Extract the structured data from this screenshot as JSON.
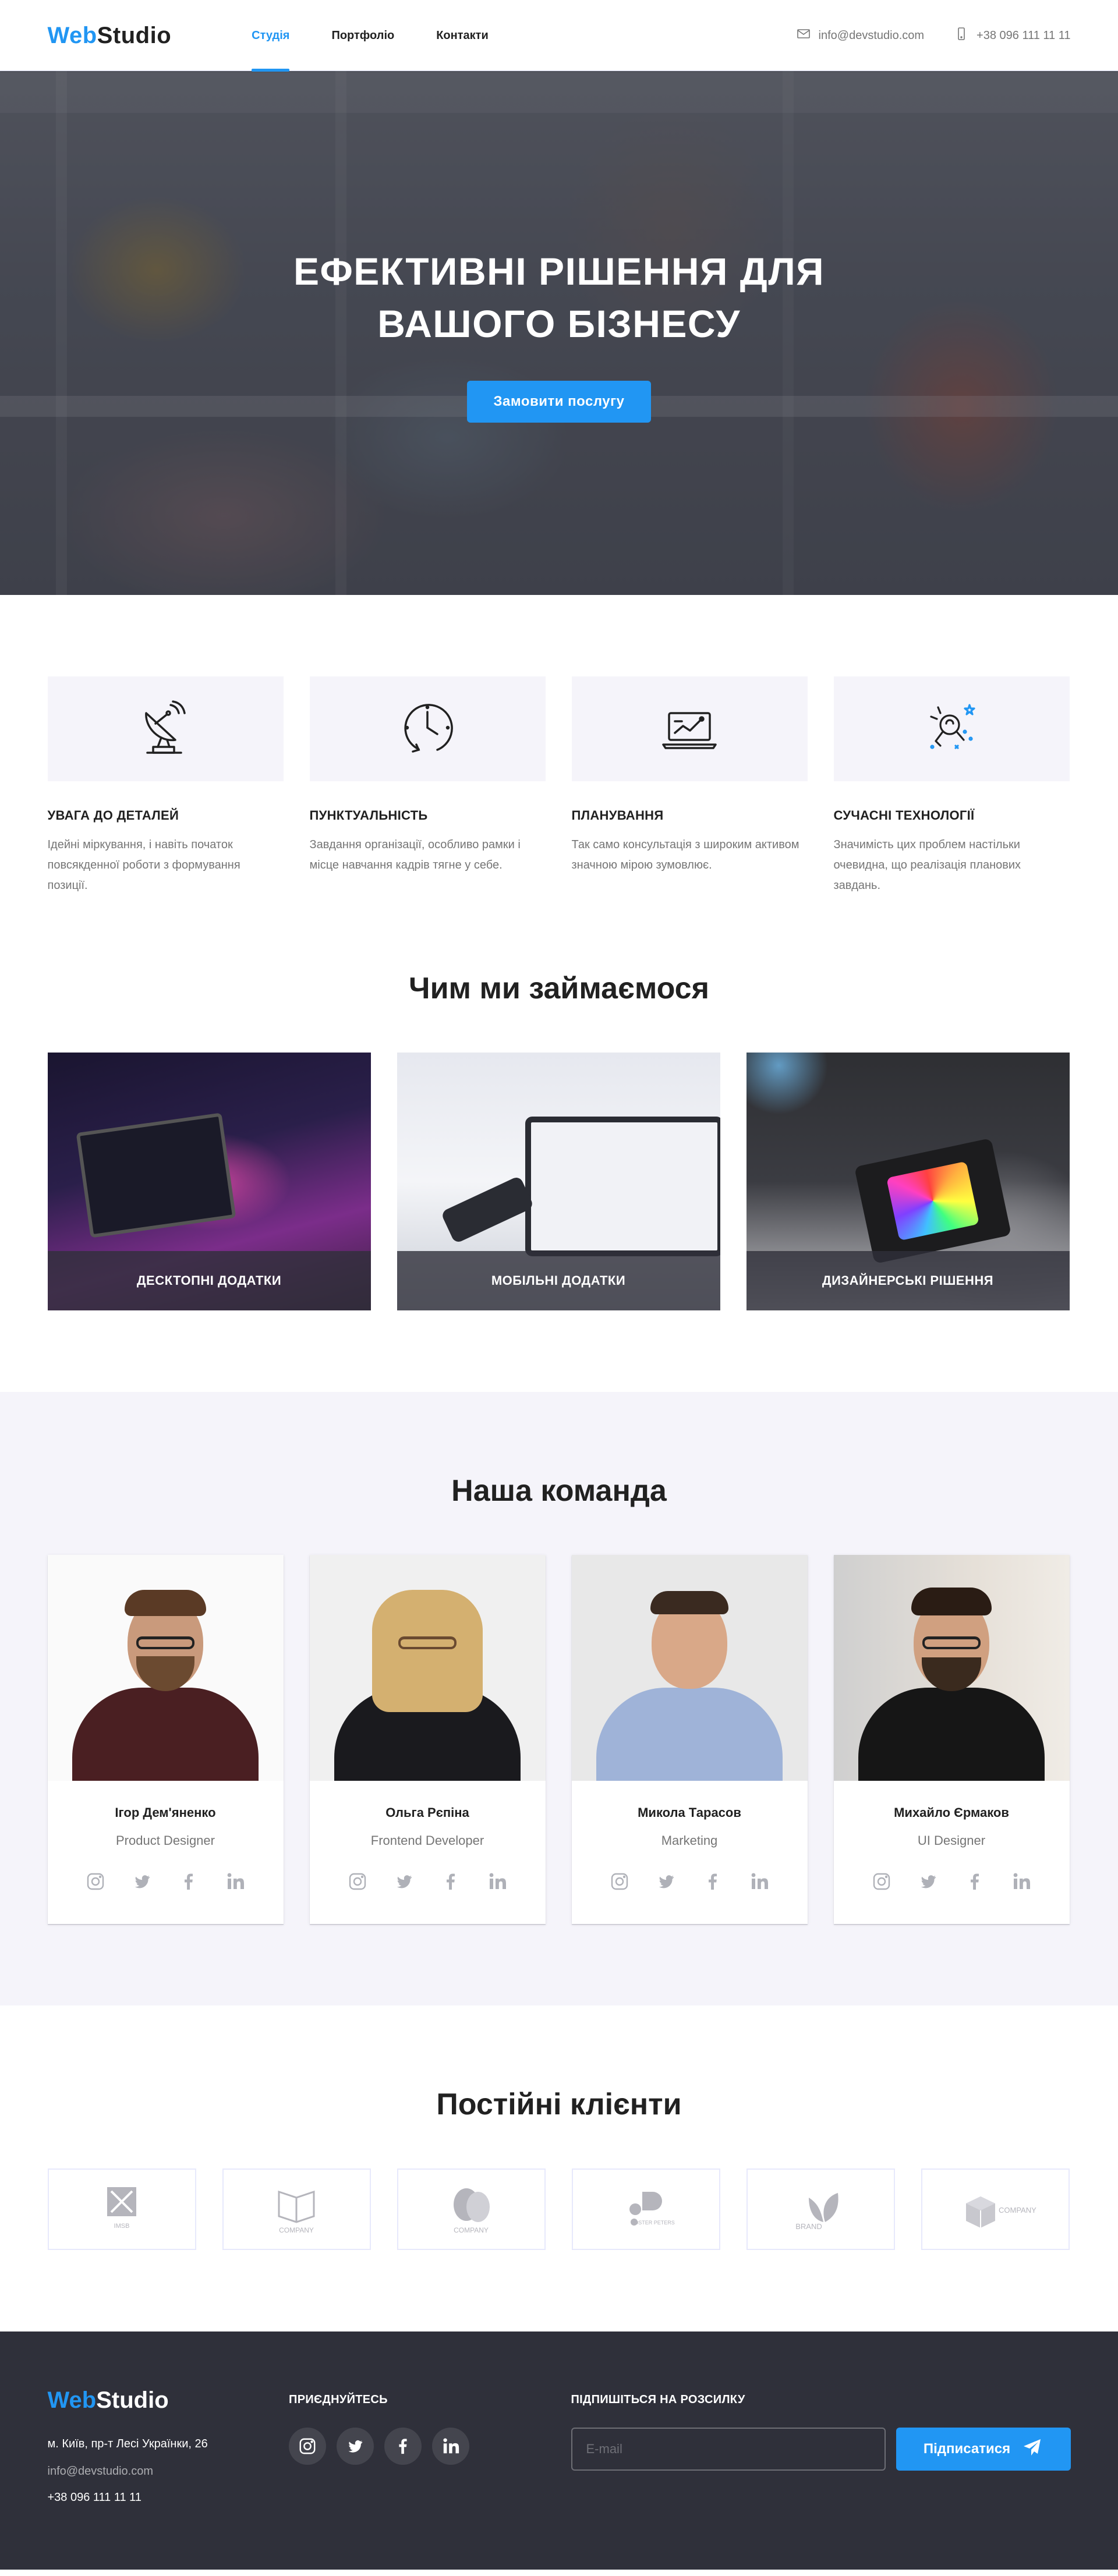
{
  "header": {
    "logo_part1": "Web",
    "logo_part2": "Studio",
    "nav": [
      "Студія",
      "Портфоліо",
      "Контакти"
    ],
    "email": "info@devstudio.com",
    "phone": "+38 096 111 11 11",
    "accent_color": "#2196f3"
  },
  "hero": {
    "title_line1": "ЕФЕКТИВНІ РІШЕННЯ ДЛЯ",
    "title_line2": "ВАШОГО БІЗНЕСУ",
    "button": "Замовити послугу"
  },
  "features": [
    {
      "icon": "satellite-dish-icon",
      "title": "Увага до деталей",
      "text": "Ідейні міркування, і навіть початок повсякденної роботи з формування позиції."
    },
    {
      "icon": "clock-icon",
      "title": "Пунктуальність",
      "text": "Завдання організації, особливо рамки і місце навчання кадрів тягне у себе."
    },
    {
      "icon": "laptop-chart-icon",
      "title": "Планування",
      "text": "Так само консультація з широким активом значною мірою зумовлює."
    },
    {
      "icon": "astronaut-icon",
      "title": "Сучасні технології",
      "text": "Значимість цих проблем настільки очевидна, що реалізація планових завдань."
    }
  ],
  "services": {
    "title": "Чим ми займаємося",
    "items": [
      "Десктопні додатки",
      "Мобільні додатки",
      "Дизайнерські рішення"
    ]
  },
  "team": {
    "title": "Наша команда",
    "members": [
      {
        "name": "Ігор Дем'яненко",
        "role": "Product Designer"
      },
      {
        "name": "Ольга Рєпіна",
        "role": "Frontend Developer"
      },
      {
        "name": "Микола Тарасов",
        "role": "Marketing"
      },
      {
        "name": "Михайло Єрмаков",
        "role": "UI Designer"
      }
    ]
  },
  "clients": {
    "title": "Постійні клієнти",
    "logos": [
      "IMSB",
      "COMPANY",
      "COMPANY",
      "POSTER PETERS",
      "BRAND",
      "COMPANY"
    ]
  },
  "footer": {
    "logo_part1": "Web",
    "logo_part2": "Studio",
    "address": "м. Київ, пр-т Лесі Українки, 26",
    "email": "info@devstudio.com",
    "phone": "+38 096 111 11 11",
    "social_heading": "Приєднуйтесь",
    "subscribe_heading": "Підпишіться на розсилку",
    "email_placeholder": "E-mail",
    "subscribe_button": "Підписатися"
  }
}
